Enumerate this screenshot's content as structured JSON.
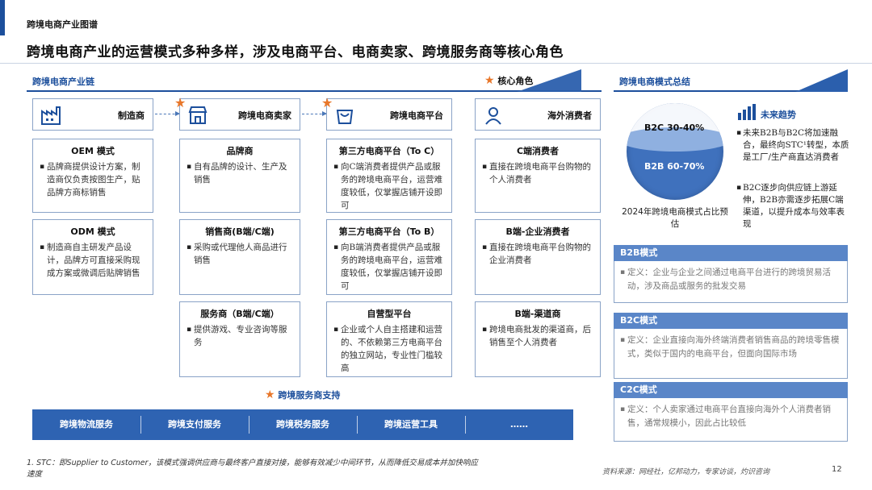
{
  "header": {
    "section_title": "跨境电商产业图谱",
    "page_title": "跨境电商产业的运营模式多种多样，涉及电商平台、电商卖家、跨境服务商等核心角色"
  },
  "chain": {
    "band_label": "跨境电商产业链",
    "core_legend": "核心角色",
    "roles": [
      {
        "label": "制造商",
        "icon": "factory-icon"
      },
      {
        "label": "跨境电商卖家",
        "icon": "store-icon"
      },
      {
        "label": "跨境电商平台",
        "icon": "shopping-bag-icon"
      },
      {
        "label": "海外消费者",
        "icon": "person-icon"
      }
    ],
    "manufacturer_cards": [
      {
        "title": "OEM 模式",
        "text": "品牌商提供设计方案，制造商仅负责按图生产，贴品牌方商标销售"
      },
      {
        "title": "ODM 模式",
        "text": "制造商自主研发产品设计，品牌方可直接采购现成方案或微调后贴牌销售"
      }
    ],
    "seller_cards": [
      {
        "title": "品牌商",
        "text": "自有品牌的设计、生产及销售"
      },
      {
        "title": "销售商(B端/C端)",
        "text": "采购或代理他人商品进行销售"
      },
      {
        "title": "服务商（B端/C端）",
        "text": "提供游戏、专业咨询等服务"
      }
    ],
    "platform_cards": [
      {
        "title": "第三方电商平台（To C）",
        "text": "向C端消费者提供产品或服务的跨境电商平台，运营难度较低，仅掌握店铺开设即可"
      },
      {
        "title": "第三方电商平台（To B）",
        "text": "向B端消费者提供产品或服务的跨境电商平台，运营难度较低，仅掌握店铺开设即可"
      },
      {
        "title": "自营型平台",
        "text": "企业或个人自主搭建和运营的、不依赖第三方电商平台的独立网站，专业性门槛较高"
      }
    ],
    "consumer_cards": [
      {
        "title": "C端消费者",
        "text": "直接在跨境电商平台购物的个人消费者"
      },
      {
        "title": "B端-企业消费者",
        "text": "直接在跨境电商平台购物的企业消费者"
      },
      {
        "title": "B端-渠道商",
        "text": "跨境电商批发的渠道商，后销售至个人消费者"
      }
    ],
    "support_label": "跨境服务商支持",
    "support_items": [
      "跨境物流服务",
      "跨境支付服务",
      "跨境税务服务",
      "跨境运营工具",
      "……"
    ]
  },
  "summary": {
    "band_label": "跨境电商模式总结",
    "chart_data": {
      "type": "pie",
      "title": "",
      "categories": [
        "B2C",
        "B2B"
      ],
      "labels": [
        "B2C 30-40%",
        "B2B 60-70%"
      ],
      "values": [
        35,
        65
      ],
      "caption": "2024年跨境电商模式占比预估"
    },
    "trend_title": "未来趋势",
    "trend_points": [
      "未来B2B与B2C将加速融合，最终向STC¹转型，本质是工厂/生产商直达消费者",
      "B2C逐步向供应链上游延伸，B2B亦需逐步拓展C端渠道，以提升成本与效率表现"
    ],
    "modes": [
      {
        "title": "B2B模式",
        "text": "定义：企业与企业之间通过电商平台进行的跨境贸易活动，涉及商品或服务的批发交易"
      },
      {
        "title": "B2C模式",
        "text": "定义：企业直接向海外终端消费者销售商品的跨境零售模式，类似于国内的电商平台，但面向国际市场"
      },
      {
        "title": "C2C模式",
        "text": "定义：个人卖家通过电商平台直接向海外个人消费者销售，通常规模小，因此占比较低"
      }
    ]
  },
  "footer": {
    "footnote": "1. STC：即Supplier to Customer，该模式强调供应商与最终客户直接对接，能够有效减少中间环节，从而降低交易成本并加快响应速度",
    "source": "资料来源：网经社，亿邦动力，专家访谈，灼识咨询",
    "page_number": "12"
  },
  "colors": {
    "accent": "#1c4f9c",
    "bar": "#2e63b2",
    "star": "#e8772a"
  }
}
